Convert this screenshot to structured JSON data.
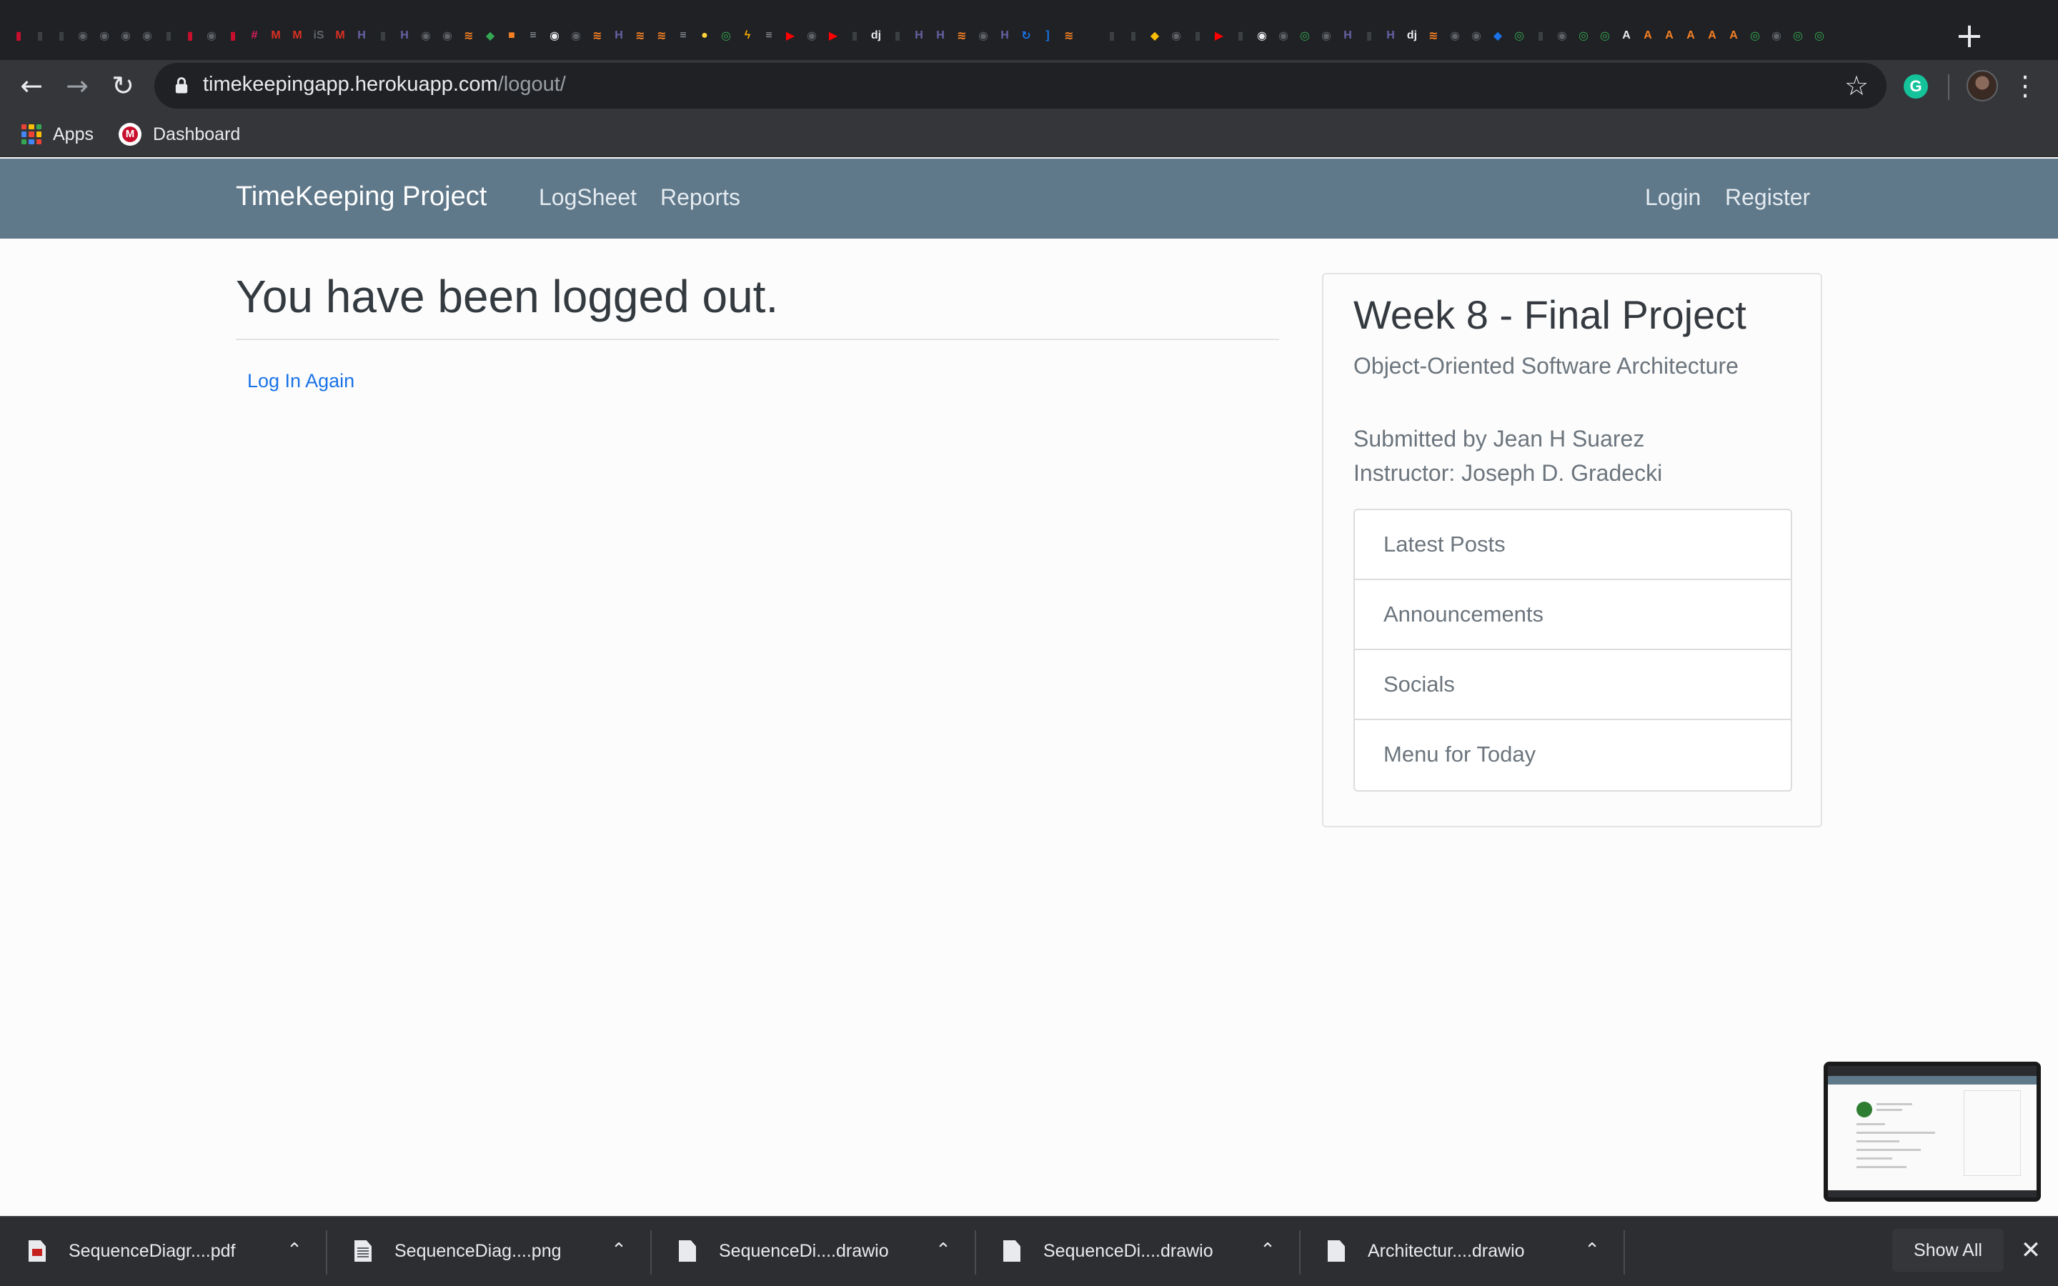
{
  "browser": {
    "tab_icons": [
      {
        "icon": "stacked-tab-icon",
        "color": "#c8102e"
      },
      {
        "icon": "stacked-tab-icon",
        "color": "#3c4043"
      },
      {
        "icon": "stacked-tab-icon",
        "color": "#3c4043"
      },
      {
        "icon": "github-icon",
        "color": "#5f6368"
      },
      {
        "icon": "github-icon",
        "color": "#5f6368"
      },
      {
        "icon": "github-icon",
        "color": "#5f6368"
      },
      {
        "icon": "github-icon",
        "color": "#5f6368"
      },
      {
        "icon": "stacked-tab-icon",
        "color": "#3c4043"
      },
      {
        "icon": "stacked-tab-icon",
        "color": "#c8102e"
      },
      {
        "icon": "github-icon",
        "color": "#5f6368"
      },
      {
        "icon": "stacked-tab-icon",
        "color": "#c8102e"
      },
      {
        "icon": "slack-icon",
        "color": "#e01e5a"
      },
      {
        "icon": "gmail-icon",
        "color": "#d93025"
      },
      {
        "icon": "gmail-icon",
        "color": "#d93025"
      },
      {
        "icon": "is-icon",
        "color": "#5f6368"
      },
      {
        "icon": "gmail-icon",
        "color": "#d93025"
      },
      {
        "icon": "heroku-icon",
        "color": "#6762a6"
      },
      {
        "icon": "stacked-tab-icon",
        "color": "#3c4043"
      },
      {
        "icon": "heroku-icon",
        "color": "#6762a6"
      },
      {
        "icon": "github-icon",
        "color": "#5f6368"
      },
      {
        "icon": "github-icon",
        "color": "#5f6368"
      },
      {
        "icon": "stackoverflow-icon",
        "color": "#f48024"
      },
      {
        "icon": "bulb-icon",
        "color": "#34a853"
      },
      {
        "icon": "orange-tab-icon",
        "color": "#f48024"
      },
      {
        "icon": "doc-icon",
        "color": "#9aa0a6"
      },
      {
        "icon": "github-icon",
        "color": "#e8eaed"
      },
      {
        "icon": "github-icon",
        "color": "#5f6368"
      },
      {
        "icon": "stackoverflow-icon",
        "color": "#f48024"
      },
      {
        "icon": "heroku-icon",
        "color": "#6762a6"
      },
      {
        "icon": "stackoverflow-icon",
        "color": "#f48024"
      },
      {
        "icon": "stackoverflow-icon",
        "color": "#f48024"
      },
      {
        "icon": "doc-icon",
        "color": "#9aa0a6"
      },
      {
        "icon": "python-icon",
        "color": "#ffd43b"
      },
      {
        "icon": "chrome-icon",
        "color": "#34a853"
      },
      {
        "icon": "lightning-icon",
        "color": "#f9ab00"
      },
      {
        "icon": "doc-icon",
        "color": "#9aa0a6"
      },
      {
        "icon": "youtube-icon",
        "color": "#ff0000"
      },
      {
        "icon": "github-icon",
        "color": "#5f6368"
      },
      {
        "icon": "youtube-icon",
        "color": "#ff0000"
      },
      {
        "icon": "stacked-tab-icon",
        "color": "#3c4043"
      },
      {
        "icon": "django-icon",
        "color": "#e8eaed"
      },
      {
        "icon": "stacked-tab-icon",
        "color": "#3c4043"
      },
      {
        "icon": "heroku-icon",
        "color": "#6762a6"
      },
      {
        "icon": "heroku-icon",
        "color": "#6762a6"
      },
      {
        "icon": "stackoverflow-icon",
        "color": "#f48024"
      },
      {
        "icon": "github-icon",
        "color": "#5f6368"
      },
      {
        "icon": "heroku-icon",
        "color": "#6762a6"
      },
      {
        "icon": "refresh-blue-icon",
        "color": "#1a73e8"
      },
      {
        "icon": "bracket-icon",
        "color": "#1a73e8"
      },
      {
        "icon": "stackoverflow-icon",
        "color": "#f48024"
      },
      {
        "icon": "dark-circle-icon",
        "color": "#202124"
      },
      {
        "icon": "stacked-tab-icon",
        "color": "#3c4043"
      },
      {
        "icon": "stacked-tab-icon",
        "color": "#3c4043"
      },
      {
        "icon": "colorful-tab-icon",
        "color": "#fbbc04"
      },
      {
        "icon": "github-icon",
        "color": "#5f6368"
      },
      {
        "icon": "stacked-tab-icon",
        "color": "#3c4043"
      },
      {
        "icon": "youtube-icon",
        "color": "#ff0000"
      },
      {
        "icon": "stacked-tab-icon",
        "color": "#3c4043"
      },
      {
        "icon": "github-icon",
        "color": "#e8eaed"
      },
      {
        "icon": "github-icon",
        "color": "#5f6368"
      },
      {
        "icon": "chrome-icon",
        "color": "#34a853"
      },
      {
        "icon": "github-icon",
        "color": "#5f6368"
      },
      {
        "icon": "heroku-icon",
        "color": "#6762a6"
      },
      {
        "icon": "stacked-tab-icon",
        "color": "#3c4043"
      },
      {
        "icon": "heroku-icon",
        "color": "#6762a6"
      },
      {
        "icon": "django-icon",
        "color": "#e8eaed"
      },
      {
        "icon": "stackoverflow-icon",
        "color": "#f48024"
      },
      {
        "icon": "github-icon",
        "color": "#5f6368"
      },
      {
        "icon": "github-icon",
        "color": "#5f6368"
      },
      {
        "icon": "gitlab-icon",
        "color": "#1a73e8"
      },
      {
        "icon": "chrome-icon",
        "color": "#34a853"
      },
      {
        "icon": "stacked-tab-icon",
        "color": "#3c4043"
      },
      {
        "icon": "github-icon",
        "color": "#5f6368"
      },
      {
        "icon": "chrome-icon",
        "color": "#34a853"
      },
      {
        "icon": "chrome-icon",
        "color": "#34a853"
      },
      {
        "icon": "acrobat-icon",
        "color": "#e8eaed"
      },
      {
        "icon": "orange-a-icon",
        "color": "#f48024"
      },
      {
        "icon": "orange-a-icon",
        "color": "#f48024"
      },
      {
        "icon": "orange-a-icon",
        "color": "#f48024"
      },
      {
        "icon": "orange-a-icon",
        "color": "#f48024"
      },
      {
        "icon": "orange-a-icon",
        "color": "#f48024"
      },
      {
        "icon": "chrome-icon",
        "color": "#34a853"
      },
      {
        "icon": "github-icon",
        "color": "#5f6368"
      },
      {
        "icon": "chrome-icon",
        "color": "#34a853"
      },
      {
        "icon": "chrome-icon",
        "color": "#34a853"
      }
    ],
    "url_host": "timekeepingapp.herokuapp.com",
    "url_path": "/logout/",
    "bookmarks": [
      {
        "label": "Apps",
        "icon": "apps-grid-icon"
      },
      {
        "label": "Dashboard",
        "icon": "dashboard-icon"
      }
    ]
  },
  "site": {
    "brand": "TimeKeeping Project",
    "nav_left": [
      "LogSheet",
      "Reports"
    ],
    "nav_right": [
      "Login",
      "Register"
    ],
    "colors": {
      "navbar": "#5f788a",
      "link": "#1a73e8"
    }
  },
  "main": {
    "heading": "You have been logged out.",
    "login_again": "Log In Again"
  },
  "sidebar": {
    "title": "Week 8 - Final Project",
    "subtitle": "Object-Oriented Software Architecture",
    "submitted": "Submitted by Jean H Suarez",
    "instructor": "Instructor: Joseph D. Gradecki",
    "links": [
      "Latest Posts",
      "Announcements",
      "Socials",
      "Menu for Today"
    ]
  },
  "downloads": {
    "items": [
      {
        "name": "SequenceDiagr....pdf",
        "icon": "pdf-file-icon"
      },
      {
        "name": "SequenceDiag....png",
        "icon": "image-file-icon"
      },
      {
        "name": "SequenceDi....drawio",
        "icon": "file-icon"
      },
      {
        "name": "SequenceDi....drawio",
        "icon": "file-icon"
      },
      {
        "name": "Architectur....drawio",
        "icon": "file-icon"
      }
    ],
    "show_all": "Show All"
  }
}
